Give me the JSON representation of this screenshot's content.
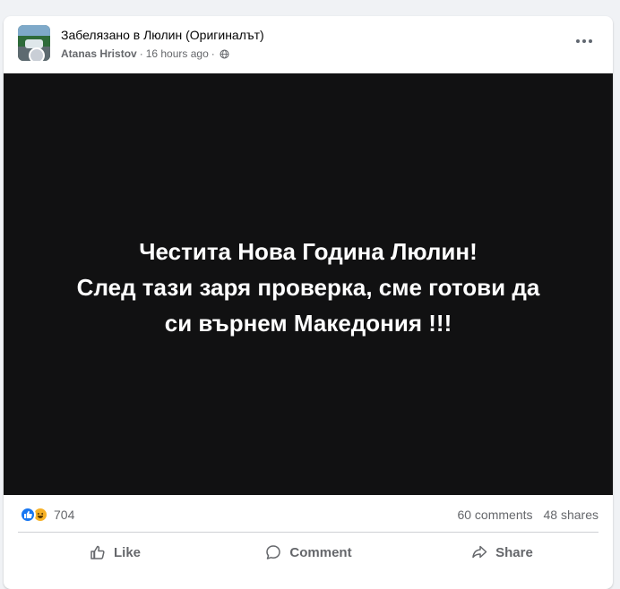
{
  "post": {
    "group_name": "Забелязано в Люлин (Оригиналът)",
    "author": "Atanas Hristov",
    "time": "16 hours ago",
    "separator": "·",
    "privacy_icon": "globe-icon",
    "more_icon": "more-options-icon",
    "media_text_lines": [
      "Честита Нова Година Люлин!",
      "След тази заря проверка, сме готови да",
      "си върнем Македония !!!"
    ],
    "reactions": {
      "icons": [
        "like-reaction-icon",
        "haha-reaction-icon"
      ],
      "count": "704"
    },
    "comments": "60 comments",
    "shares": "48 shares",
    "actions": {
      "like": "Like",
      "comment": "Comment",
      "share": "Share"
    }
  },
  "colors": {
    "page_bg": "#f0f2f5",
    "card_bg": "#ffffff",
    "media_bg": "#111112",
    "media_text": "#ffffff",
    "secondary_text": "#65676b",
    "like_blue": "#1877f2",
    "haha_yellow": "#f7b125"
  }
}
